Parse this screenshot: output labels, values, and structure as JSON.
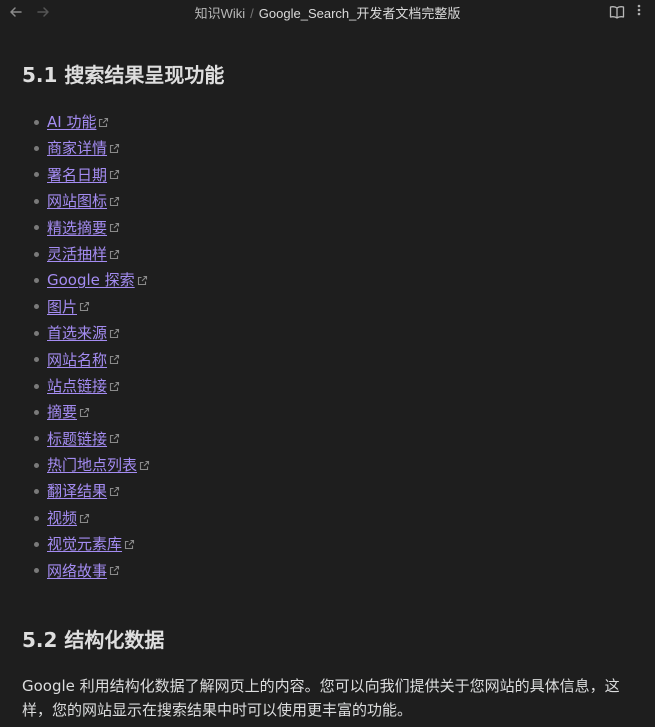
{
  "header": {
    "vault": "知识Wiki",
    "separator": "/",
    "title": "Google_Search_开发者文档完整版"
  },
  "section1": {
    "heading": "5.1 搜索结果呈现功能",
    "items": [
      "AI 功能",
      "商家详情",
      "署名日期",
      "网站图标",
      "精选摘要",
      "灵活抽样",
      "Google 探索",
      "图片",
      "首选来源",
      "网站名称",
      "站点链接",
      "摘要",
      "标题链接",
      "热门地点列表",
      "翻译结果",
      "视频",
      "视觉元素库",
      "网络故事"
    ]
  },
  "section2": {
    "heading": "5.2 结构化数据",
    "paragraph": "Google 利用结构化数据了解网页上的内容。您可以向我们提供关于您网站的具体信息，这样，您的网站显示在搜索结果中时可以使用更丰富的功能。"
  },
  "colors": {
    "background": "#1e1e1e",
    "link": "#a48cf2"
  }
}
